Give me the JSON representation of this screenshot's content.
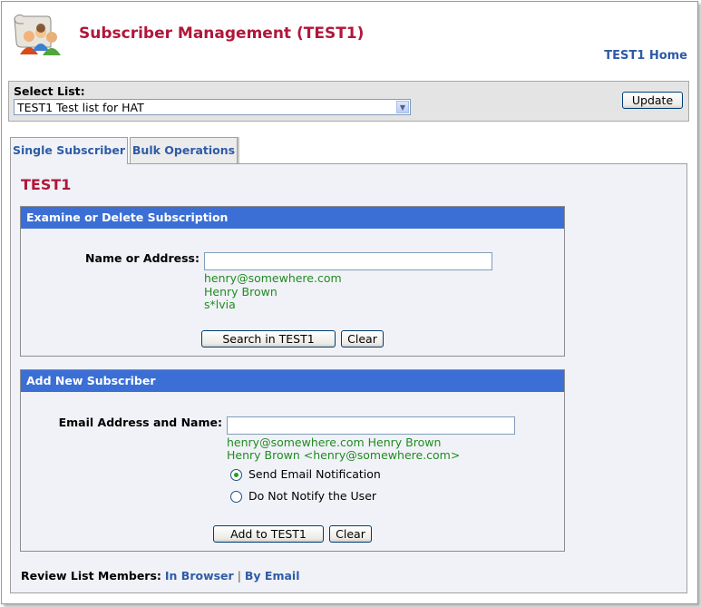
{
  "header": {
    "title": "Subscriber Management (TEST1)",
    "home_link": "TEST1 Home"
  },
  "list_selector": {
    "label": "Select List:",
    "selected": "TEST1 Test list for HAT",
    "update_button": "Update"
  },
  "tabs": [
    {
      "label": "Single Subscriber",
      "active": true
    },
    {
      "label": "Bulk Operations",
      "active": false
    }
  ],
  "list_name": "TEST1",
  "examine_section": {
    "heading": "Examine or Delete Subscription",
    "field_label": "Name or Address:",
    "value": "",
    "hints": [
      "henry@somewhere.com",
      "Henry Brown",
      "s*lvia"
    ],
    "search_button": "Search in TEST1",
    "clear_button": "Clear"
  },
  "add_section": {
    "heading": "Add New Subscriber",
    "field_label": "Email Address and Name:",
    "value": "",
    "hints": [
      "henry@somewhere.com Henry Brown",
      "Henry Brown <henry@somewhere.com>"
    ],
    "radio_options": [
      {
        "label": "Send Email Notification",
        "checked": true
      },
      {
        "label": "Do Not Notify the User",
        "checked": false
      }
    ],
    "add_button": "Add to TEST1",
    "clear_button": "Clear"
  },
  "review": {
    "label": "Review List Members:",
    "link_browser": "In Browser",
    "separator": "|",
    "link_email": "By Email"
  },
  "colors": {
    "title_red": "#b0173a",
    "link_blue": "#2f5ba6",
    "section_header_blue": "#3b6fd6",
    "hint_green": "#228b22"
  }
}
